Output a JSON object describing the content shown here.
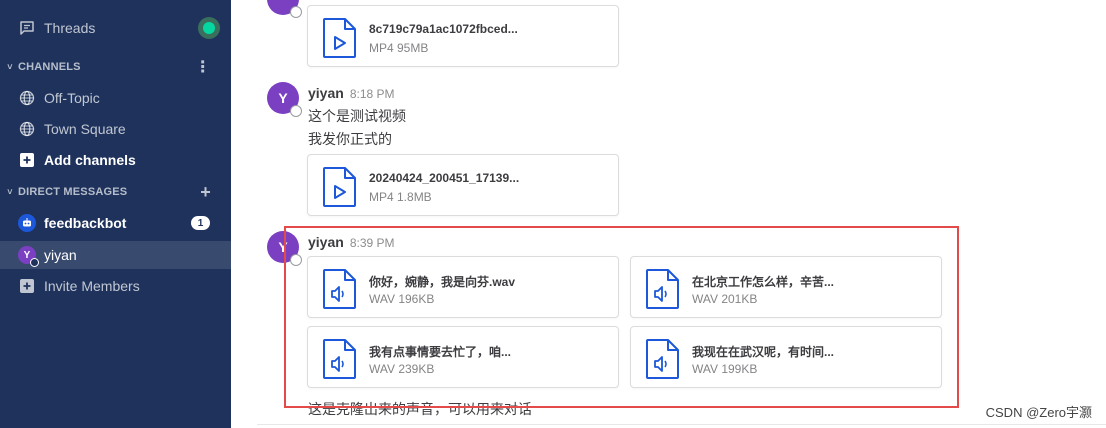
{
  "sidebar": {
    "threads_label": "Threads",
    "channels_header": "CHANNELS",
    "channels_menu_icon": "⋮",
    "channels": [
      {
        "label": "Off-Topic",
        "icon": "globe-icon"
      },
      {
        "label": "Town Square",
        "icon": "globe-icon"
      }
    ],
    "add_channels_label": "Add channels",
    "direct_messages_header": "DIRECT MESSAGES",
    "dm_add_icon": "+",
    "direct_messages": [
      {
        "label": "feedbackbot",
        "unread": "1"
      },
      {
        "label": "yiyan",
        "avatar_initial": "Y"
      }
    ],
    "invite_members_label": "Invite Members"
  },
  "messages": [
    {
      "files": [
        {
          "name": "8c719c79a1ac1072fbced...",
          "meta": "MP4 95MB",
          "type": "video"
        }
      ]
    },
    {
      "avatar_initial": "Y",
      "user": "yiyan",
      "time": "8:18 PM",
      "lines": [
        "这个是测试视频",
        "我发你正式的"
      ],
      "files": [
        {
          "name": "20240424_200451_17139...",
          "meta": "MP4 1.8MB",
          "type": "video"
        }
      ]
    },
    {
      "avatar_initial": "Y",
      "user": "yiyan",
      "time": "8:39 PM",
      "files": [
        {
          "name": "你好，婉静，我是向芬.wav",
          "meta": "WAV 196KB",
          "type": "audio"
        },
        {
          "name": "在北京工作怎么样，辛苦...",
          "meta": "WAV 201KB",
          "type": "audio"
        },
        {
          "name": "我有点事情要去忙了，咱...",
          "meta": "WAV 239KB",
          "type": "audio"
        },
        {
          "name": "我现在在武汉呢，有时间...",
          "meta": "WAV 199KB",
          "type": "audio"
        }
      ],
      "caption": "这是克隆出来的声音，可以用来对话"
    }
  ],
  "watermark": "CSDN @Zero宇灏",
  "colors": {
    "sidebar_bg": "#1e325c",
    "avatar": "#7b3fc2",
    "file_icon": "#1c58d9",
    "highlight_border": "#e34b4b",
    "online_dot": "#06d6a0"
  }
}
